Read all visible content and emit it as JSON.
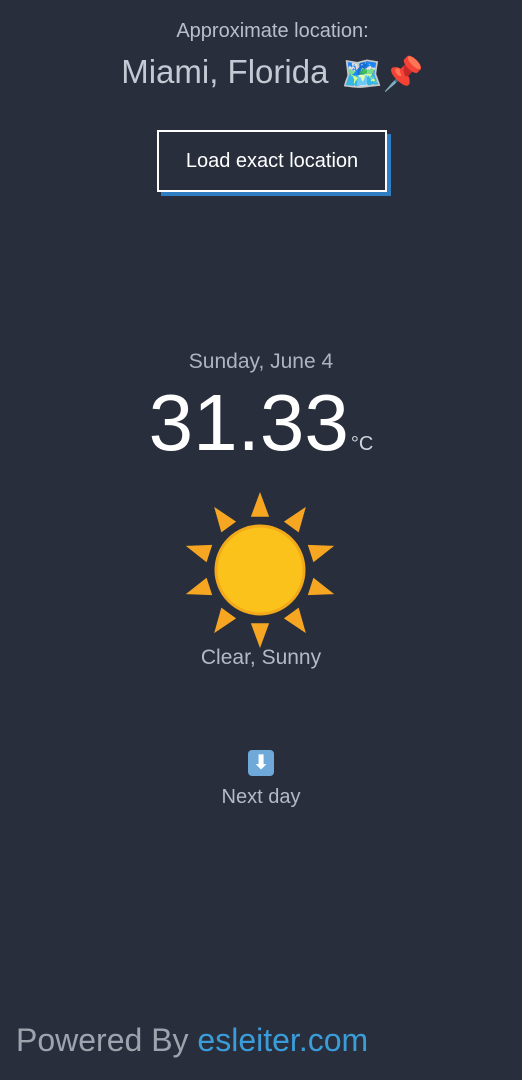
{
  "location": {
    "label": "Approximate location:",
    "city": "Miami, Florida",
    "emojis": "🗺️📌"
  },
  "load_button": {
    "label": "Load exact location"
  },
  "weather": {
    "date": "Sunday, June 4",
    "temperature": "31.33",
    "unit": "°C",
    "condition": "Clear, Sunny",
    "icon": "sun-icon"
  },
  "next_day": {
    "arrow": "⬇",
    "label": "Next day"
  },
  "footer": {
    "powered_by": "Powered By ",
    "link": "esleiter.com"
  },
  "colors": {
    "background": "#282e3b",
    "accent": "#3a9cd8",
    "sun": "#fbc21b",
    "ray": "#f7a622"
  }
}
